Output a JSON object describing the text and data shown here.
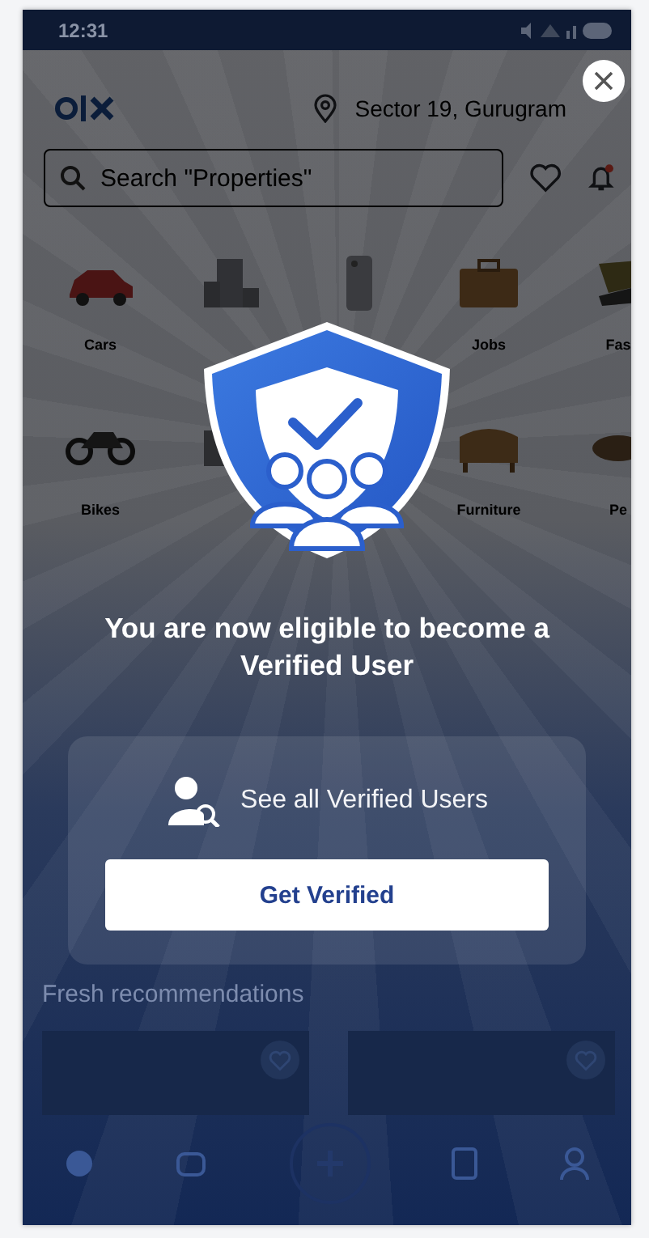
{
  "status_bar": {
    "time": "12:31"
  },
  "header": {
    "location": "Sector 19, Gurugram"
  },
  "search": {
    "placeholder": "Search \"Properties\""
  },
  "categories": [
    {
      "label": "Cars",
      "kind": "car"
    },
    {
      "kind": "building"
    },
    {
      "kind": "phone"
    },
    {
      "label": "Jobs",
      "kind": "briefcase"
    },
    {
      "label": "Fas",
      "kind": "shoe"
    },
    {
      "label": "Bikes",
      "kind": "bike"
    },
    {
      "kind": "tv"
    },
    {
      "label": "Furniture",
      "kind": "sofa"
    },
    {
      "label": "Pe",
      "kind": "bowl"
    }
  ],
  "fresh_section": {
    "title": "Fresh recommendations"
  },
  "dialog": {
    "title": "You are now eligible to become a Verified User",
    "link": "See all Verified Users",
    "button": "Get Verified"
  }
}
